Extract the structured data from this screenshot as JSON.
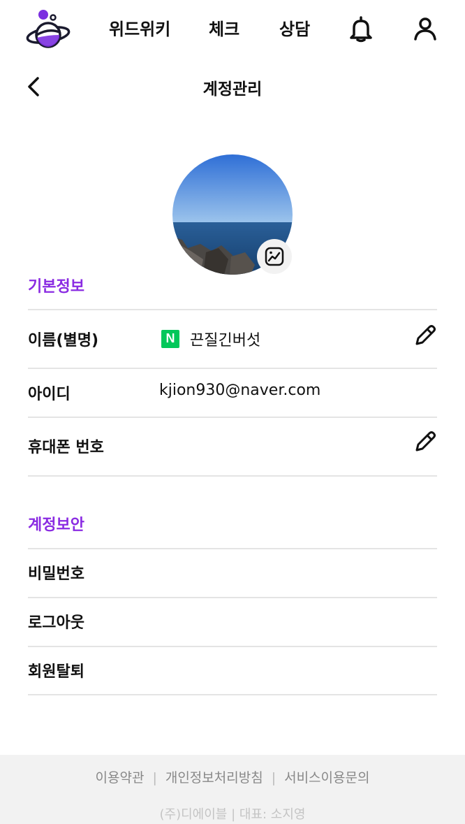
{
  "nav": {
    "logo_icon": "planet-logo-icon",
    "links": [
      "위드위키",
      "체크",
      "상담"
    ],
    "notification_icon": "bell-icon",
    "profile_icon": "user-icon"
  },
  "header": {
    "back_icon": "chevron-left-icon",
    "title": "계정관리"
  },
  "profile": {
    "photo": "ocean-horizon-photo",
    "edit_icon": "image-edit-icon"
  },
  "basic_info": {
    "title": "기본정보",
    "name_label": "이름(별명)",
    "login_badge": "N",
    "name_value": "끈질긴버섯",
    "id_label": "아이디",
    "id_value": "kjion930@naver.com",
    "phone_label": "휴대폰 번호",
    "edit_icon": "pencil-icon"
  },
  "security": {
    "title": "계정보안",
    "items": [
      "비밀번호",
      "로그아웃",
      "회원탈퇴"
    ]
  },
  "footer": {
    "links": [
      "이용약관",
      "개인정보처리방침",
      "서비스이용문의"
    ],
    "separator": "|",
    "company": "(주)디에이블 | 대표: 소지영"
  },
  "colors": {
    "accent": "#8a2be2",
    "naver_green": "#03c75a",
    "footer_bg": "#f2f2f2"
  }
}
